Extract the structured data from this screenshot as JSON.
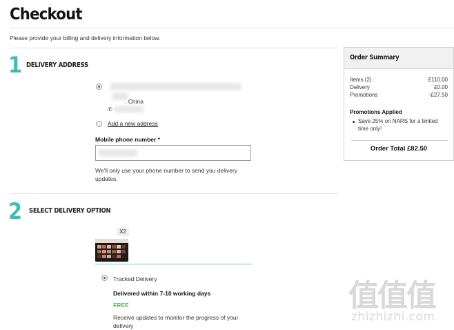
{
  "page": {
    "title": "Checkout",
    "intro": "Please provide your billing and delivery information below."
  },
  "step1": {
    "number": "1",
    "title": "DELIVERY ADDRESS",
    "address_country": ", China",
    "add_new_address": "Add a new address",
    "phone_label": "Mobile phone number *",
    "phone_value": "",
    "phone_note_line1": "We'll only use your phone number to send you delivery",
    "phone_note_line2": "updates."
  },
  "step2": {
    "number": "2",
    "title": "SELECT DELIVERY OPTION",
    "quantity": "X2",
    "option_label": "Tracked Delivery",
    "delivery_time": "Delivered within 7-10 working days",
    "price": "FREE",
    "updates_line1": "Receive updates to monitor the progress of your",
    "updates_line2": "delivery"
  },
  "summary": {
    "title": "Order Summary",
    "rows": [
      {
        "label": "Items (2)",
        "value": "£110.00"
      },
      {
        "label": "Delivery",
        "value": "£0.00"
      },
      {
        "label": "Promotions",
        "value": "-£27.50"
      }
    ],
    "promotions_heading": "Promotions Applied",
    "promotion_line1": "Save 25% on NARS for a limited",
    "promotion_line2": "time only!",
    "total": "Order Total £82.50"
  },
  "watermark": {
    "glyphs": "值值值",
    "domain": "zhizhizhi.com"
  },
  "colors": {
    "accent_teal": "#3dbdb3",
    "free_green": "#5cb85c"
  }
}
